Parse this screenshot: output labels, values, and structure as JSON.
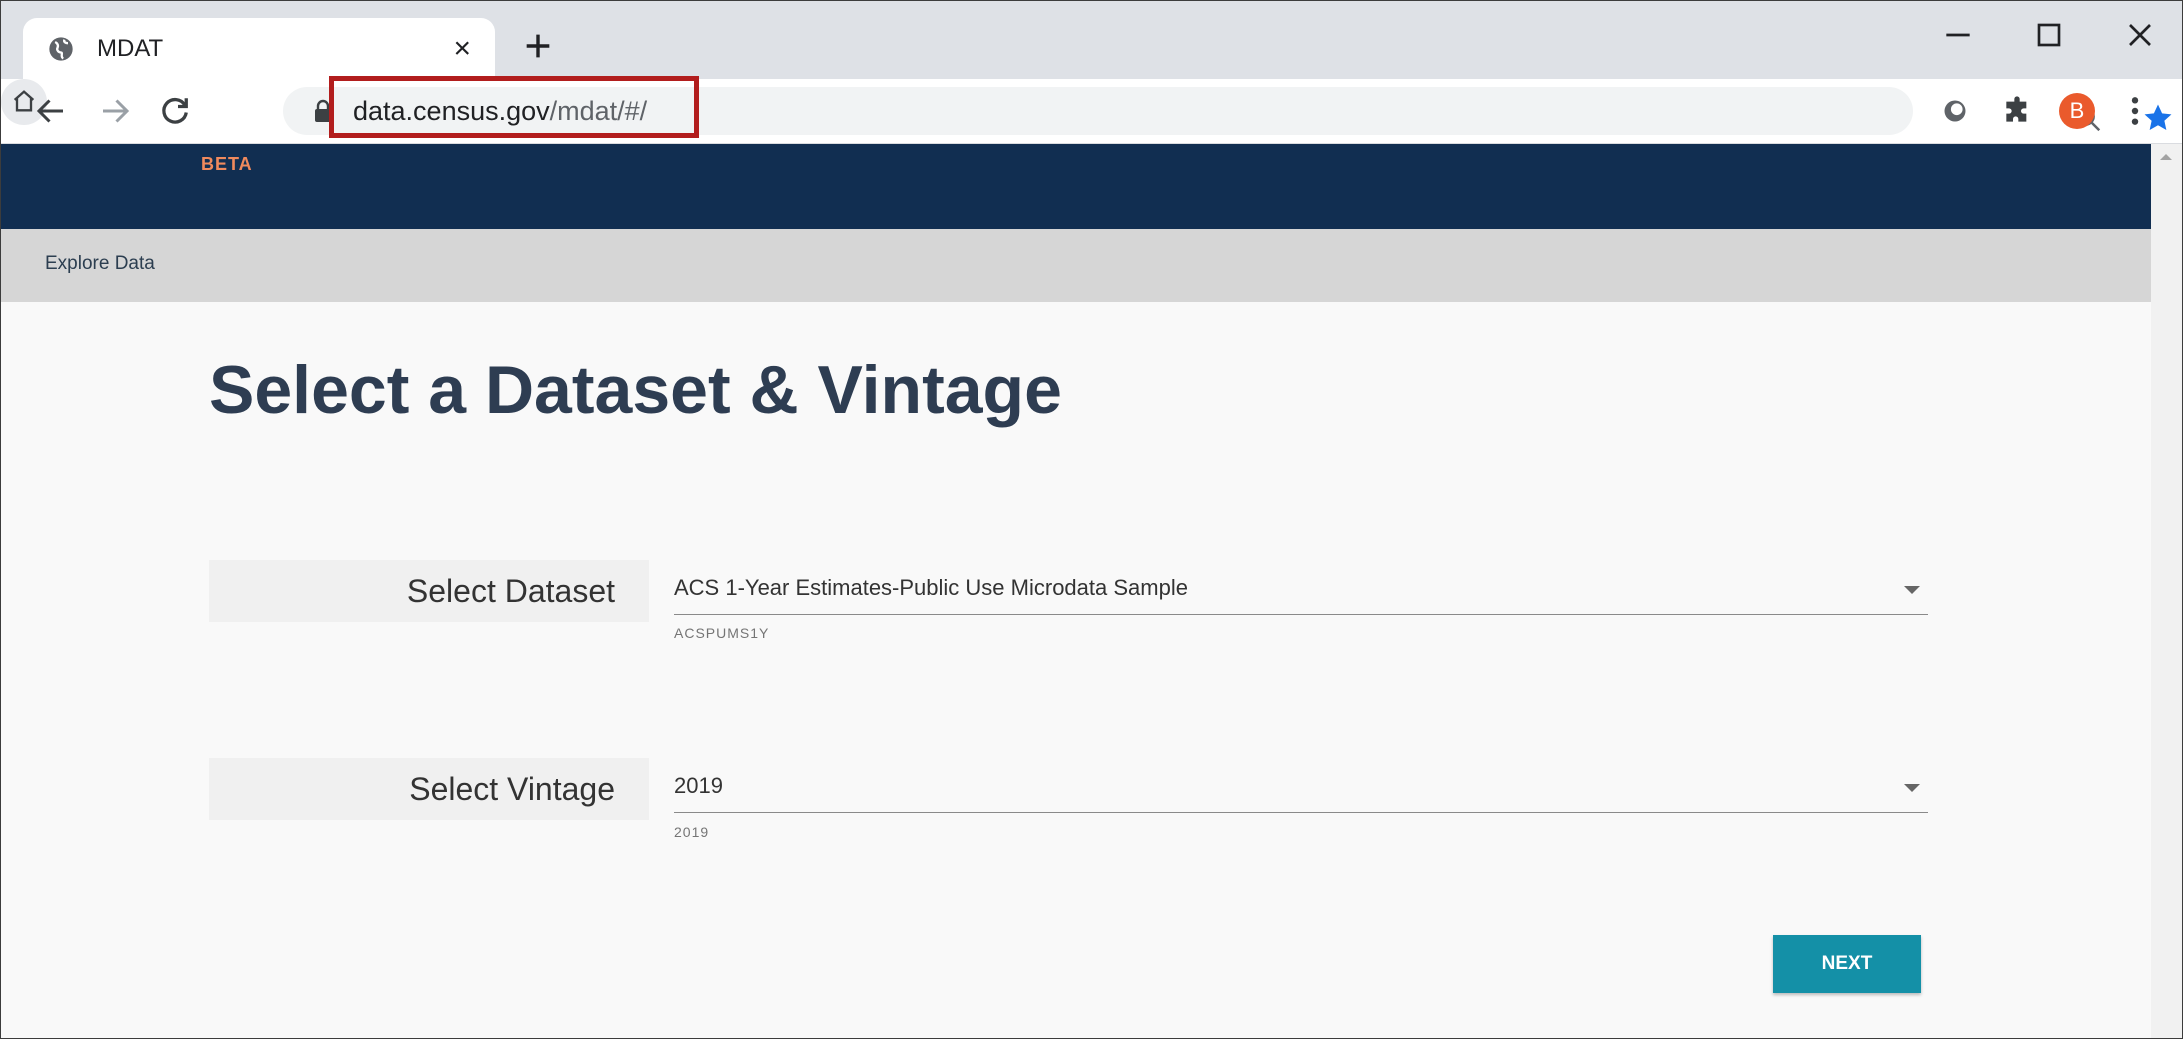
{
  "browser": {
    "tab": {
      "title": "MDAT",
      "close_glyph": "×"
    },
    "new_tab_glyph": "+",
    "address": {
      "host": "data.census.gov",
      "path": "/mdat/#/"
    },
    "avatar_letter": "B",
    "icons": {
      "favicon": "globe-icon",
      "back": "arrow-left-icon",
      "forward": "arrow-right-icon",
      "reload": "reload-icon",
      "home": "home-icon",
      "lock": "lock-icon",
      "zoom": "zoom-out-icon",
      "bookmark": "star-icon",
      "extensions": "puzzle-icon",
      "menu": "kebab-menu-icon"
    },
    "colors": {
      "highlight_box": "#b21d1d",
      "bookmark_star": "#1a73e8",
      "avatar": "#ea5a2c"
    }
  },
  "site": {
    "header": {
      "badge": "BETA"
    },
    "breadcrumb": "Explore Data",
    "colors": {
      "header_bg": "#112e51",
      "badge": "#f08a5d",
      "button": "#1490a7"
    }
  },
  "main": {
    "title": "Select a Dataset & Vintage",
    "dataset": {
      "label": "Select Dataset",
      "value": "ACS 1-Year Estimates-Public Use Microdata Sample",
      "hint": "ACSPUMS1Y"
    },
    "vintage": {
      "label": "Select Vintage",
      "value": "2019",
      "hint": "2019"
    },
    "next_label": "NEXT"
  }
}
